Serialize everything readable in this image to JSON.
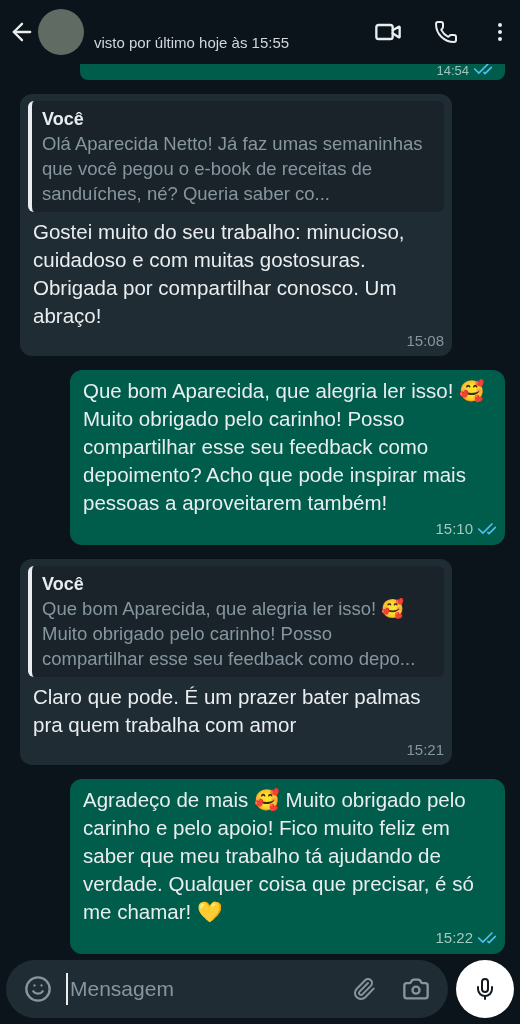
{
  "header": {
    "status": "visto por último hoje às 15:55"
  },
  "messages": [
    {
      "kind": "outgoing",
      "partial": true,
      "time": "14:54",
      "read": true
    },
    {
      "kind": "incoming",
      "quote": {
        "author": "Você",
        "text": "Olá Aparecida Netto! Já faz umas semaninhas que você pegou o e-book de receitas de sanduíches, né? Queria saber co..."
      },
      "text": "Gostei muito do seu trabalho: minucioso, cuidadoso e com muitas gostosuras. Obrigada por compartilhar conosco. Um abraço!",
      "time": "15:08"
    },
    {
      "kind": "outgoing",
      "text": "Que bom Aparecida, que alegria ler isso! 🥰 Muito obrigado pelo carinho! Posso compartilhar esse seu feedback como depoimento? Acho que pode inspirar mais pessoas a aproveitarem também!",
      "time": "15:10",
      "read": true
    },
    {
      "kind": "incoming",
      "quote": {
        "author": "Você",
        "text": "Que bom Aparecida, que alegria ler isso! 🥰 Muito obrigado pelo carinho! Posso compartilhar esse seu feedback como depo..."
      },
      "text": "Claro que pode. É um prazer bater palmas pra quem trabalha com amor",
      "time": "15:21"
    },
    {
      "kind": "outgoing",
      "text": "Agradeço de mais 🥰 Muito obrigado pelo carinho e pelo apoio! Fico muito feliz em saber que meu trabalho tá ajudando de verdade. Qualquer coisa que precisar, é só me chamar! 💛",
      "time": "15:22",
      "read": true
    }
  ],
  "composer": {
    "placeholder": "Mensagem"
  }
}
